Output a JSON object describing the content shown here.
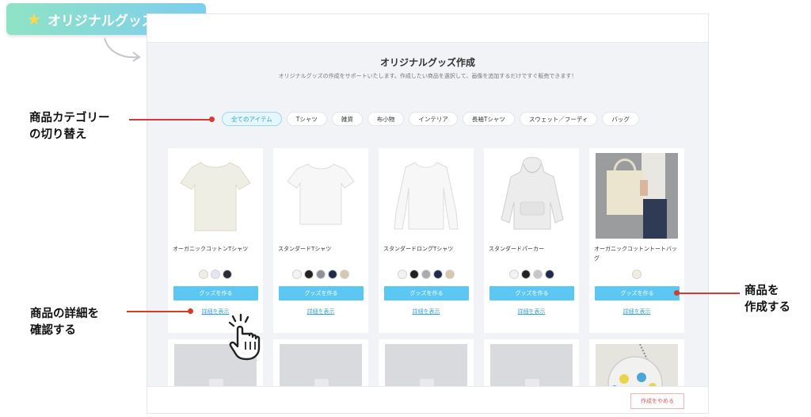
{
  "badge": {
    "label": "オリジナルグッズ作成",
    "icon": "star-icon"
  },
  "page": {
    "title": "オリジナルグッズ作成",
    "subtitle": "オリジナルグッズの作成をサポートいたします。作成したい商品を選択して、画像を追加するだけですぐ販売できます！"
  },
  "categories": [
    {
      "label": "全てのアイテム",
      "active": true
    },
    {
      "label": "Tシャツ",
      "active": false
    },
    {
      "label": "雑貨",
      "active": false
    },
    {
      "label": "布小物",
      "active": false
    },
    {
      "label": "インテリア",
      "active": false
    },
    {
      "label": "長袖Tシャツ",
      "active": false
    },
    {
      "label": "スウェット／フーディ",
      "active": false
    },
    {
      "label": "バッグ",
      "active": false
    }
  ],
  "products": [
    {
      "name": "オーガニックコットンTシャツ",
      "colors": [
        "#efeee2",
        "#e1e6f2",
        "#2b2d36"
      ],
      "button": "グッズを作る",
      "detail": "詳細を表示"
    },
    {
      "name": "スタンダードTシャツ",
      "colors": [
        "#f2f2f2",
        "#222222",
        "#8e9096",
        "#1f2b4a",
        "#d6c7ad"
      ],
      "button": "グッズを作る",
      "detail": "詳細を表示"
    },
    {
      "name": "スタンダードロングTシャツ",
      "colors": [
        "#f2f2f2",
        "#222222",
        "#a9abaf",
        "#1f2b4a",
        "#d6c7ad"
      ],
      "button": "グッズを作る",
      "detail": "詳細を表示"
    },
    {
      "name": "スタンダードパーカー",
      "colors": [
        "#f2f2f2",
        "#222222",
        "#c4c6cc",
        "#1f2b4a"
      ],
      "button": "グッズを作る",
      "detail": "詳細を表示"
    },
    {
      "name": "オーガニックコットントートバッグ",
      "colors": [
        "#efece0"
      ],
      "button": "グッズを作る",
      "detail": "詳細を表示"
    }
  ],
  "footer": {
    "cancel_label": "作成をやめる"
  },
  "callouts": {
    "category": [
      "商品カテゴリー",
      "の切り替え"
    ],
    "detail": [
      "商品の詳細を",
      "確認する"
    ],
    "create": [
      "商品を",
      "作成する"
    ]
  },
  "colors": {
    "accent": "#5bc7f2",
    "annotation": "#d93a2e",
    "badge_from": "#8fe3c4",
    "badge_to": "#7dcdf0"
  }
}
